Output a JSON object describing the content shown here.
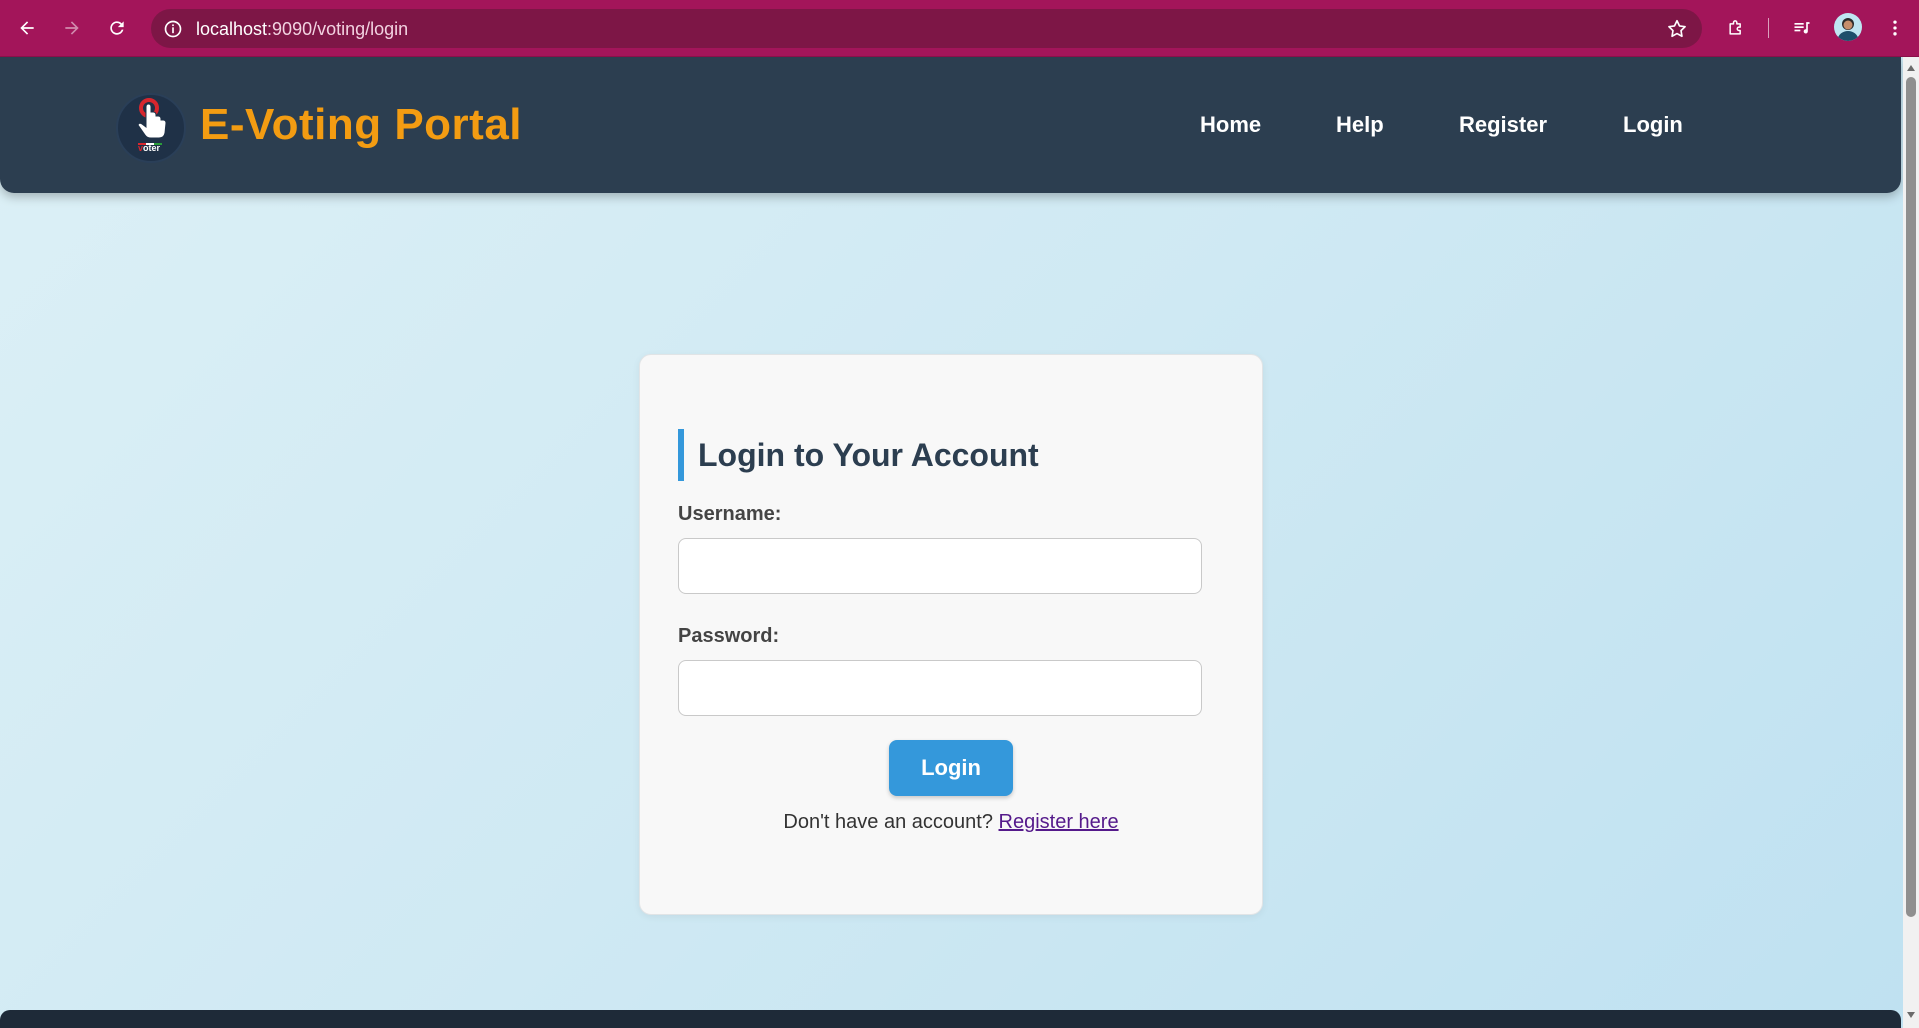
{
  "browser": {
    "url_host": "localhost",
    "url_rest": ":9090/voting/login",
    "icons": {
      "back": "arrow-left-icon",
      "forward": "arrow-right-icon",
      "reload": "reload-icon",
      "site_info": "info-icon",
      "bookmark": "star-icon",
      "extensions": "puzzle-icon",
      "media": "media-queue-icon",
      "profile": "avatar",
      "menu": "kebab-menu-icon"
    },
    "theme_color": "#a3155a"
  },
  "header": {
    "logo_text_v": "v",
    "logo_text_rest": "oter",
    "title": "E-Voting Portal",
    "title_color": "#f39c12",
    "background": "#2c3e50",
    "nav": [
      {
        "label": "Home"
      },
      {
        "label": "Help"
      },
      {
        "label": "Register"
      },
      {
        "label": "Login"
      }
    ]
  },
  "login": {
    "heading": "Login to Your Account",
    "username_label": "Username:",
    "username_value": "",
    "password_label": "Password:",
    "password_value": "",
    "submit_label": "Login",
    "register_prompt": "Don't have an account?",
    "register_link": "Register here",
    "accent_color": "#3498db"
  }
}
